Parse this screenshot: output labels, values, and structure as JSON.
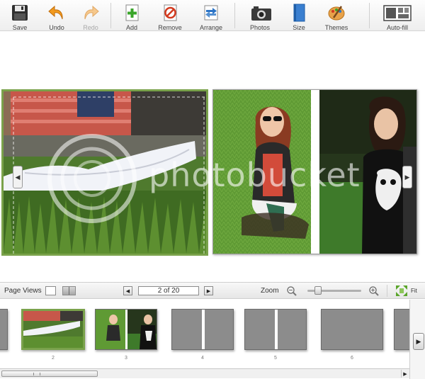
{
  "toolbar": {
    "buttons": [
      {
        "label": "Save",
        "icon": "floppy-disk-icon"
      },
      {
        "label": "Undo",
        "icon": "undo-arrow-icon"
      },
      {
        "label": "Redo",
        "icon": "redo-arrow-icon",
        "disabled": true
      },
      {
        "label": "Add",
        "icon": "add-page-icon"
      },
      {
        "label": "Remove",
        "icon": "remove-icon"
      },
      {
        "label": "Arrange",
        "icon": "arrange-icon"
      },
      {
        "label": "Photos",
        "icon": "camera-icon"
      },
      {
        "label": "Size",
        "icon": "book-size-icon"
      },
      {
        "label": "Themes",
        "icon": "palette-icon"
      },
      {
        "label": "Auto-fill",
        "icon": "auto-fill-icon"
      }
    ]
  },
  "canvas": {
    "watermark": "photobucket"
  },
  "viewbar": {
    "page_views_label": "Page Views",
    "page_indicator": "2 of 20",
    "zoom_label": "Zoom",
    "zoom_level": 0.15,
    "fit_label": "Fit"
  },
  "filmstrip": {
    "pages": [
      "2",
      "3",
      "4",
      "5",
      "6"
    ]
  },
  "colors": {
    "selection_green": "#7aa24b",
    "toolbar_text": "#444444",
    "placeholder_gray": "#8c8c8c"
  }
}
